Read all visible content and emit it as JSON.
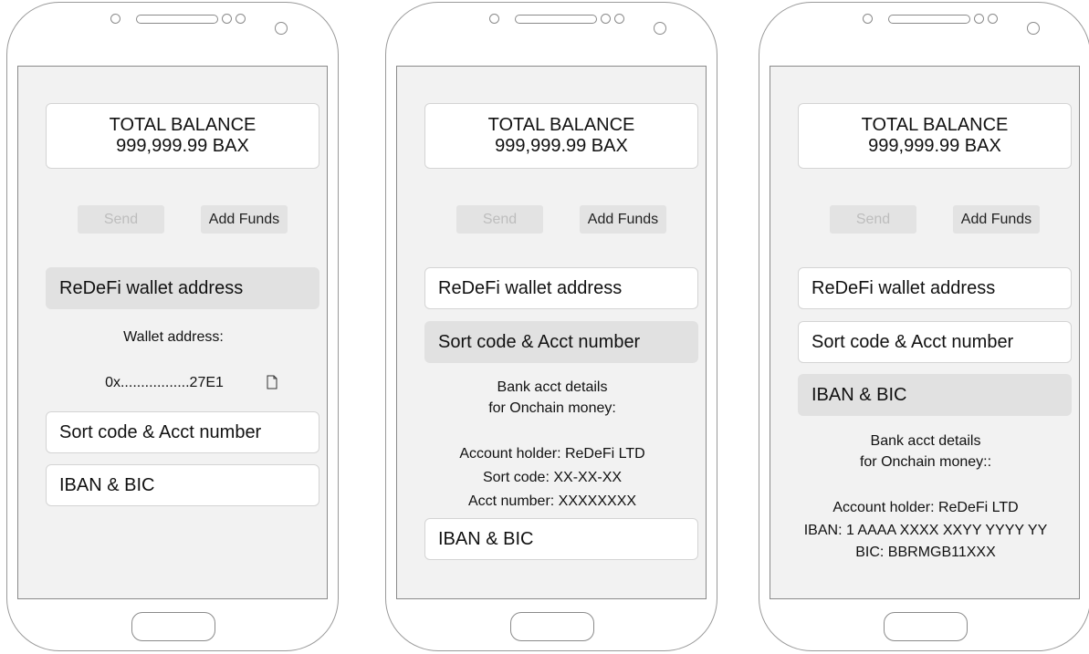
{
  "screens": [
    {
      "balance_label": "TOTAL BALANCE",
      "balance_value": "999,999.99 BAX",
      "send_label": "Send",
      "add_funds_label": "Add Funds",
      "sections": [
        "ReDeFi wallet address",
        "Sort code & Acct number",
        "IBAN & BIC"
      ],
      "open_section": 0,
      "wallet_label": "Wallet address:",
      "wallet_value": "0x.................27E1"
    },
    {
      "balance_label": "TOTAL BALANCE",
      "balance_value": "999,999.99 BAX",
      "send_label": "Send",
      "add_funds_label": "Add Funds",
      "sections": [
        "ReDeFi wallet address",
        "Sort code & Acct number",
        "IBAN & BIC"
      ],
      "open_section": 1,
      "details_title_1": "Bank acct details",
      "details_title_2": "for Onchain money:",
      "account_holder": "Account holder: ReDeFi LTD",
      "sort_code": "Sort code: XX-XX-XX",
      "acct_number": "Acct number: XXXXXXXX"
    },
    {
      "balance_label": "TOTAL BALANCE",
      "balance_value": "999,999.99 BAX",
      "send_label": "Send",
      "add_funds_label": "Add Funds",
      "sections": [
        "ReDeFi wallet address",
        "Sort code & Acct number",
        "IBAN & BIC"
      ],
      "open_section": 2,
      "details_title_1": "Bank acct details",
      "details_title_2": "for Onchain money::",
      "account_holder": "Account holder: ReDeFi LTD",
      "iban": "IBAN: 1 AAAA XXXX XXYY YYYY YY",
      "bic": "BIC: BBRMGB11XXX"
    }
  ]
}
